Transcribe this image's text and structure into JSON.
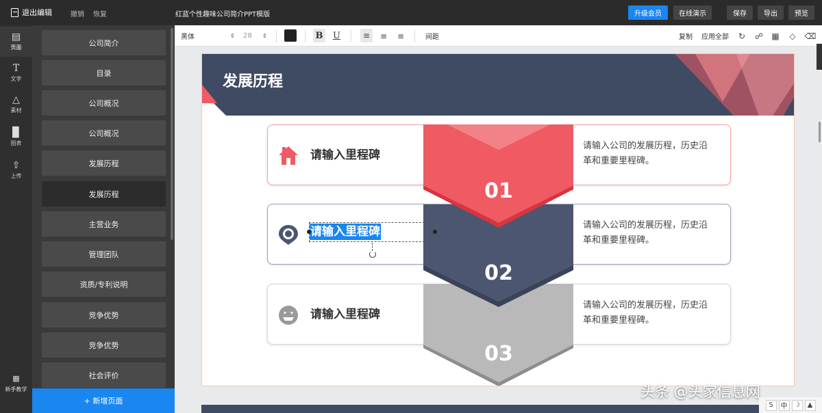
{
  "topbar": {
    "exit_label": "退出编辑",
    "undo_label": "撤销",
    "redo_label": "恢复",
    "doc_title": "红蓝个性趣味公司简介PPT模版",
    "upgrade_label": "升级会员",
    "present_label": "在线演示",
    "save_label": "保存",
    "export_label": "导出",
    "preview_label": "预览"
  },
  "rail": {
    "pages": "页面",
    "text": "文字",
    "assets": "素材",
    "chart": "图表",
    "upload": "上传",
    "tutorial": "新手教学"
  },
  "pages": [
    {
      "label": "公司简介"
    },
    {
      "label": "目录"
    },
    {
      "label": "公司概况"
    },
    {
      "label": "公司概况"
    },
    {
      "label": "发展历程"
    },
    {
      "label": "发展历程"
    },
    {
      "label": "主营业务"
    },
    {
      "label": "管理团队"
    },
    {
      "label": "资质/专利说明"
    },
    {
      "label": "竞争优势"
    },
    {
      "label": "竞争优势"
    },
    {
      "label": "社会评价"
    }
  ],
  "add_page_label": "+ 新增页面",
  "format": {
    "font_family": "黑体",
    "font_size": "28",
    "bold": "B",
    "underline": "U",
    "spacing_label": "间距",
    "copy_label": "复制",
    "apply_all_label": "应用全部"
  },
  "slide": {
    "title": "发展历程",
    "milestones": [
      {
        "title": "请输入里程碑",
        "desc": "请输入公司的发展历程，历史沿革和重要里程碑。",
        "number": "01",
        "icon": "house-icon"
      },
      {
        "title": "请输入里程碑",
        "desc": "请输入公司的发展历程，历史沿革和重要里程碑。",
        "number": "02",
        "icon": "location-pin-icon"
      },
      {
        "title": "请输入里程碑",
        "desc": "请输入公司的发展历程，历史沿革和重要里程碑。",
        "number": "03",
        "icon": "pumpkin-face-icon"
      }
    ]
  },
  "colors": {
    "accent_blue": "#1a86f0",
    "slide_navy": "#3f4a63",
    "slide_red": "#ef5a63",
    "slide_gray": "#b9b9b9"
  },
  "watermark": "头条 @头家信息网",
  "ime": {
    "b1": "S",
    "b2": "中"
  }
}
